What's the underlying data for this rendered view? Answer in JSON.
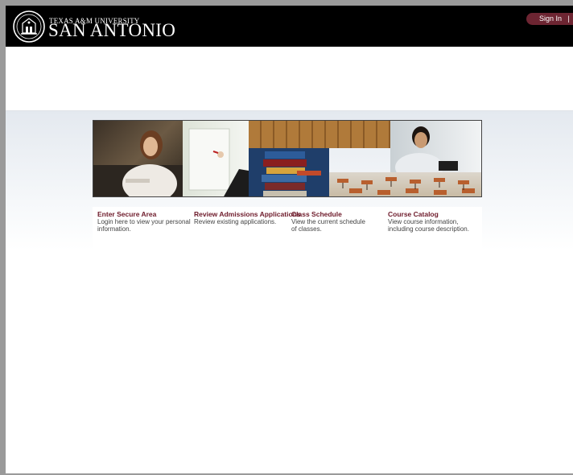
{
  "header": {
    "university_line": "TEXAS A&M UNIVERSITY",
    "campus_name": "SAN ANTONIO",
    "signin_label": "Sign In",
    "signin_separator": "|"
  },
  "banner": {
    "panels": [
      {
        "subject": "student-portrait"
      },
      {
        "subject": "whiteboard-writing"
      },
      {
        "subject": "lockers"
      },
      {
        "subject": "book-stack"
      },
      {
        "subject": "student-with-laptop"
      },
      {
        "subject": "classroom-desks"
      }
    ]
  },
  "links": [
    {
      "title": "Enter Secure Area",
      "description": "Login here to view your personal information."
    },
    {
      "title": "Review Admissions Applications",
      "description": "Review existing applications."
    },
    {
      "title": "Class Schedule",
      "description": "View the current schedule of classes."
    },
    {
      "title": "Course Catalog",
      "description": "View course information, including course description."
    }
  ],
  "colors": {
    "header_bg": "#000000",
    "accent_maroon": "#6d1a2a",
    "signin_bg": "#6d2532"
  }
}
